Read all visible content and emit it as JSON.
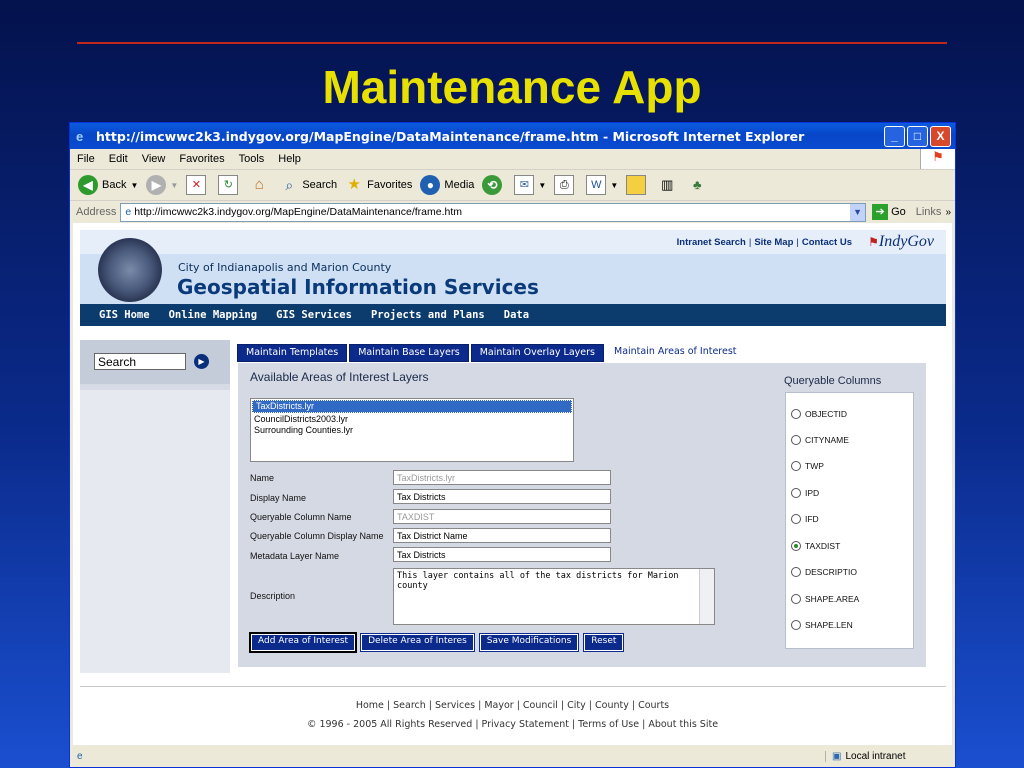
{
  "slide": {
    "title": "Maintenance App"
  },
  "window": {
    "title": "http://imcwwc2k3.indygov.org/MapEngine/DataMaintenance/frame.htm - Microsoft Internet Explorer",
    "controls": [
      "_",
      "□",
      "X"
    ]
  },
  "menu": [
    "File",
    "Edit",
    "View",
    "Favorites",
    "Tools",
    "Help"
  ],
  "toolbar": {
    "back": "Back",
    "search": "Search",
    "favorites": "Favorites",
    "media": "Media"
  },
  "address": {
    "label": "Address",
    "url": "http://imcwwc2k3.indygov.org/MapEngine/DataMaintenance/frame.htm",
    "go": "Go",
    "links": "Links"
  },
  "site": {
    "toplinks": [
      "Intranet Search",
      "Site Map",
      "Contact Us"
    ],
    "logo": "IndyGov",
    "city": "City of Indianapolis and Marion County",
    "title": "Geospatial Information Services",
    "nav": [
      "GIS Home",
      "Online Mapping",
      "GIS Services",
      "Projects and Plans",
      "Data"
    ]
  },
  "sidebar": {
    "search_value": "Search"
  },
  "tabs": [
    "Maintain Templates",
    "Maintain Base Layers",
    "Maintain Overlay Layers",
    "Maintain Areas of Interest"
  ],
  "panel": {
    "heading": "Available Areas of Interest Layers",
    "layers": [
      "TaxDistricts.lyr",
      "CouncilDistricts2003.lyr",
      "Surrounding Counties.lyr"
    ],
    "fields": {
      "name_label": "Name",
      "name_value": "TaxDistricts.lyr",
      "display_label": "Display Name",
      "display_value": "Tax Districts",
      "qcol_label": "Queryable Column Name",
      "qcol_value": "TAXDIST",
      "qdisp_label": "Queryable Column Display Name",
      "qdisp_value": "Tax District Name",
      "meta_label": "Metadata Layer Name",
      "meta_value": "Tax Districts",
      "desc_label": "Description",
      "desc_value": "This layer contains all of the tax districts for Marion county"
    },
    "buttons": [
      "Add Area of Interest",
      "Delete Area of Interes",
      "Save Modifications",
      "Reset"
    ]
  },
  "queryable": {
    "title": "Queryable Columns",
    "columns": [
      "OBJECTID",
      "CITYNAME",
      "TWP",
      "IPD",
      "IFD",
      "TAXDIST",
      "DESCRIPTIO",
      "SHAPE.AREA",
      "SHAPE.LEN"
    ],
    "selected": "TAXDIST"
  },
  "footer": {
    "links": "Home | Search | Services | Mayor | Council | City | County | Courts",
    "copyright": "© 1996 - 2005 All Rights Reserved | Privacy Statement | Terms of Use | About this Site"
  },
  "statusbar": {
    "zone": "Local intranet"
  }
}
